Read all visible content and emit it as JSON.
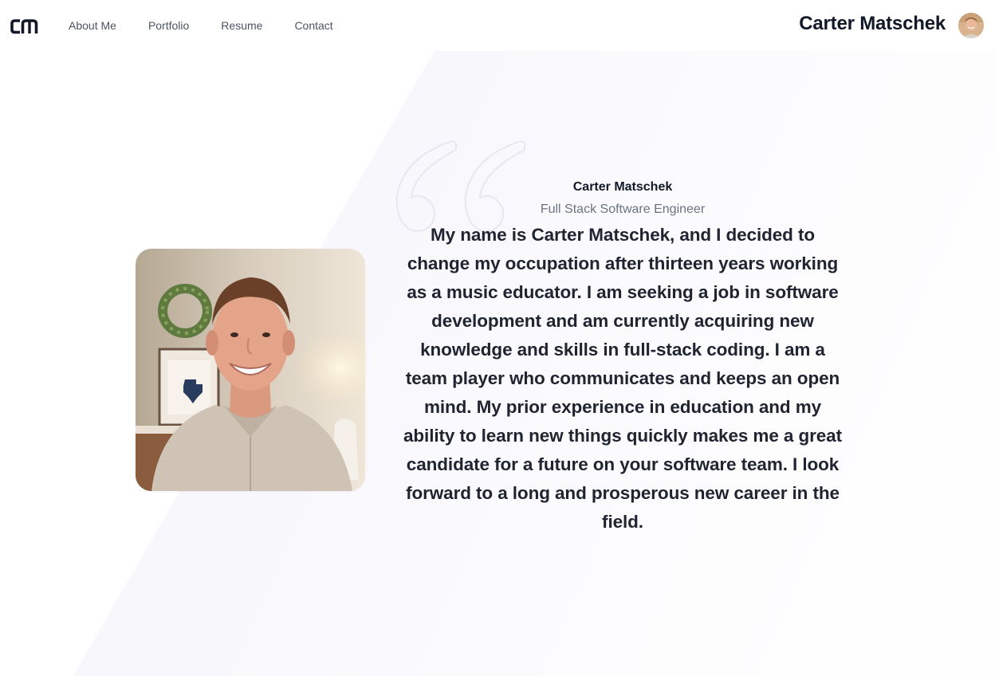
{
  "header": {
    "logo_text": "CM",
    "nav": [
      {
        "label": "About Me"
      },
      {
        "label": "Portfolio"
      },
      {
        "label": "Resume"
      },
      {
        "label": "Contact"
      }
    ],
    "owner_name": "Carter Matschek"
  },
  "profile": {
    "name": "Carter Matschek",
    "title": "Full Stack Software Engineer",
    "bio": "My name is Carter Matschek, and I decided to change my occupation after thirteen years working as a music educator. I am seeking a job in software development and am currently acquiring new knowledge and skills in full-stack coding. I am a team player who communicates and keeps an open mind. My prior experience in education and my ability to learn new things quickly makes me a great candidate for a future on your software team. I look forward to a long and prosperous new career in the field."
  },
  "colors": {
    "text_primary": "#111827",
    "text_secondary": "#6b7280",
    "nav_text": "#4b5563",
    "background_tint": "#f5f5fa"
  },
  "icons": {
    "logo": "cm-logo-icon",
    "quote": "quote-mark-icon",
    "avatar": "avatar-photo",
    "portrait": "portrait-photo"
  }
}
